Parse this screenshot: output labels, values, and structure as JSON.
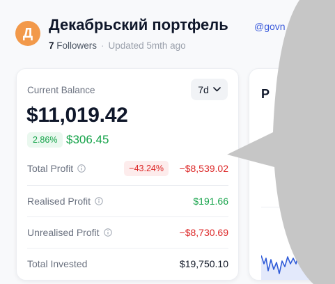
{
  "header": {
    "avatar_letter": "Д",
    "title": "Декабрьский портфель",
    "handle": "@govn",
    "followers_count": "7",
    "followers_label": "Followers",
    "separator": "·",
    "updated": "Updated 5mth ago"
  },
  "balance_card": {
    "label": "Current Balance",
    "range": "7d",
    "balance": "$11,019.42",
    "change_pct": "2.86%",
    "change_value": "$306.45",
    "rows": [
      {
        "label": "Total Profit",
        "badge": "−43.24%",
        "value": "−$8,539.02"
      },
      {
        "label": "Realised Profit",
        "value": "$191.66"
      },
      {
        "label": "Unrealised Profit",
        "value": "−$8,730.69"
      },
      {
        "label": "Total Invested",
        "value": "$19,750.10"
      }
    ]
  },
  "side_card": {
    "title_partial": "P"
  },
  "colors": {
    "accent_orange": "#f2994a",
    "positive": "#16a34a",
    "negative": "#dc2626",
    "link": "#3b5bdb",
    "overlay_gray": "#c6c6c6"
  },
  "icons": {
    "range_toggle": "chevron-down-icon",
    "row_info": "info-icon"
  }
}
